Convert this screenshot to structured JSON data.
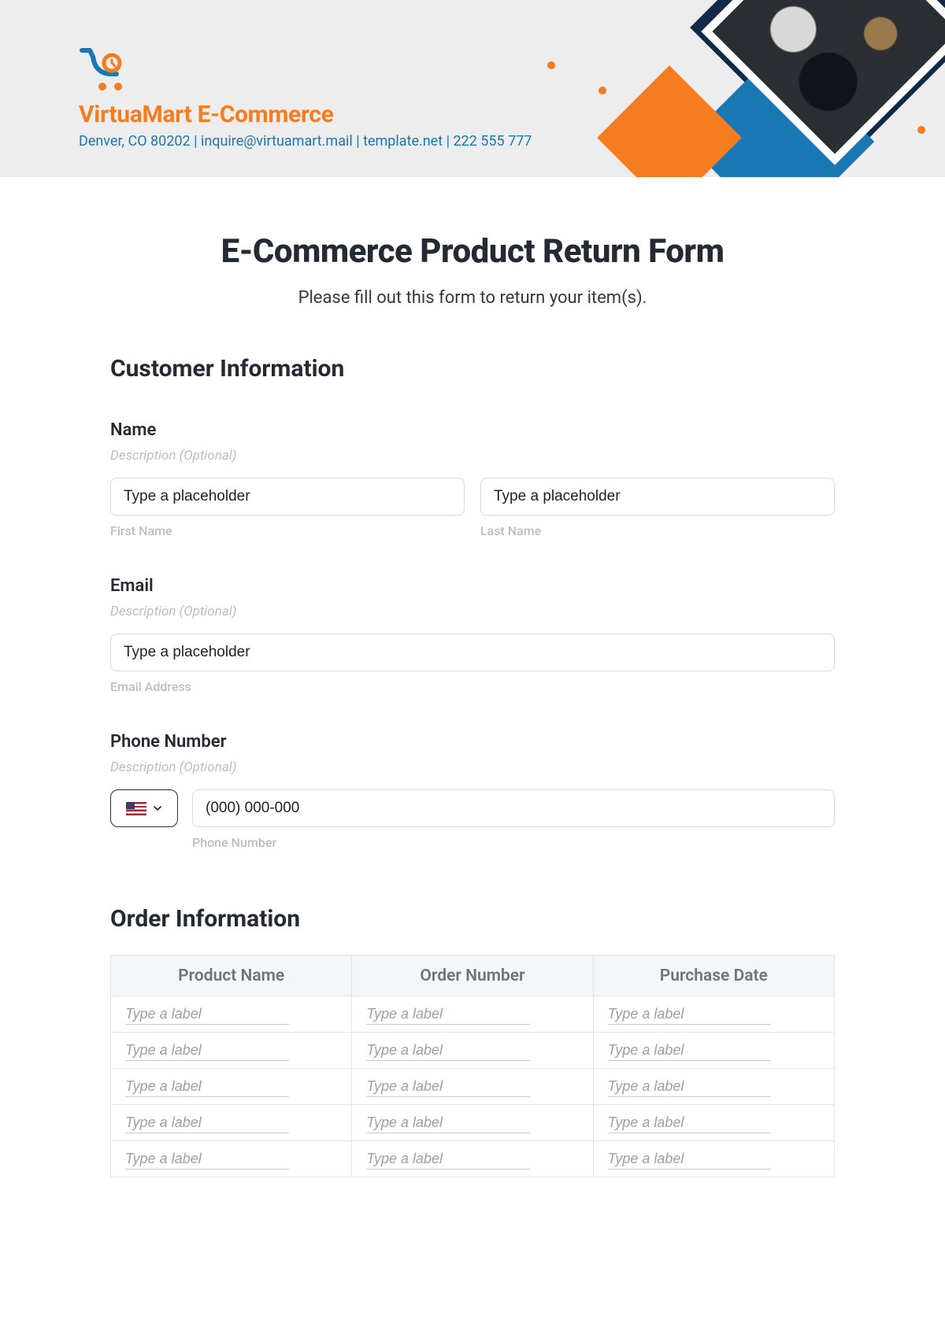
{
  "brand": {
    "name": "VirtuaMart E-Commerce",
    "contact_line": "Denver, CO 80202 | inquire@virtuamart.mail | template.net | 222 555 777"
  },
  "colors": {
    "accent_orange": "#f57c1f",
    "accent_blue": "#1978b3",
    "navy": "#12294a"
  },
  "form": {
    "title": "E-Commerce Product Return Form",
    "subtitle": "Please fill out this form to return your item(s)."
  },
  "sections": {
    "customer": "Customer Information",
    "order": "Order Information"
  },
  "fields": {
    "name": {
      "label": "Name",
      "desc": "Description (Optional)",
      "first_placeholder": "Type a placeholder",
      "last_placeholder": "Type a placeholder",
      "first_sub": "First Name",
      "last_sub": "Last Name"
    },
    "email": {
      "label": "Email",
      "desc": "Description (Optional)",
      "placeholder": "Type a placeholder",
      "sub": "Email Address"
    },
    "phone": {
      "label": "Phone Number",
      "desc": "Description (Optional)",
      "placeholder": "(000) 000-000",
      "sub": "Phone Number",
      "country": "US"
    }
  },
  "order_table": {
    "headers": [
      "Product Name",
      "Order Number",
      "Purchase Date"
    ],
    "cell_placeholder": "Type a label",
    "row_count": 5
  }
}
